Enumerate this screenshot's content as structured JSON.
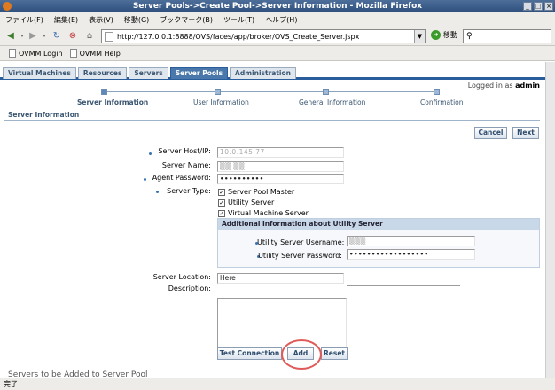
{
  "window": {
    "title": "Server Pools->Create Pool->Server Information - Mozilla Firefox"
  },
  "menubar": {
    "items": [
      "ファイル(F)",
      "編集(E)",
      "表示(V)",
      "移動(G)",
      "ブックマーク(B)",
      "ツール(T)",
      "ヘルプ(H)"
    ]
  },
  "navbar": {
    "url": "http://127.0.0.1:8888/OVS/faces/app/broker/OVS_Create_Server.jspx",
    "go_label": "移動",
    "search_icon": "magnifier-icon"
  },
  "bookmarks": {
    "items": [
      "OVMM Login",
      "OVMM Help"
    ]
  },
  "tabs": {
    "items": [
      "Virtual Machines",
      "Resources",
      "Servers",
      "Server Pools",
      "Administration"
    ],
    "active": "Server Pools"
  },
  "header": {
    "logged_in_prefix": "Logged in as",
    "user": "admin"
  },
  "train": {
    "steps": [
      "Server Information",
      "User Information",
      "General Information",
      "Confirmation"
    ]
  },
  "section": {
    "title": "Server Information"
  },
  "buttons": {
    "cancel": "Cancel",
    "next": "Next",
    "test_connection": "Test Connection",
    "add": "Add",
    "reset": "Reset"
  },
  "form": {
    "host_label": "Server Host/IP:",
    "host_value": "10.0.145.77",
    "name_label": "Server Name:",
    "name_value": "▒▒ ▒▒",
    "agent_password_label": "Agent Password:",
    "agent_password_value": "••••••••••",
    "server_type_label": "Server Type:",
    "server_types": [
      "Server Pool Master",
      "Utility Server",
      "Virtual Machine Server"
    ],
    "location_label": "Server Location:",
    "location_value": "Here",
    "description_label": "Description:"
  },
  "additional_info": {
    "title": "Additional Information about Utility Server",
    "username_label": "Utility Server Username:",
    "username_value": "▒▒▒",
    "password_label": "Utility Server Password:",
    "password_value": "••••••••••••••••••"
  },
  "footer_text": "Servers to be Added to Server Pool",
  "statusbar": {
    "text": "完了"
  },
  "colors": {
    "accent": "#2a5d9c",
    "highlight_circle": "#e05a5a"
  }
}
